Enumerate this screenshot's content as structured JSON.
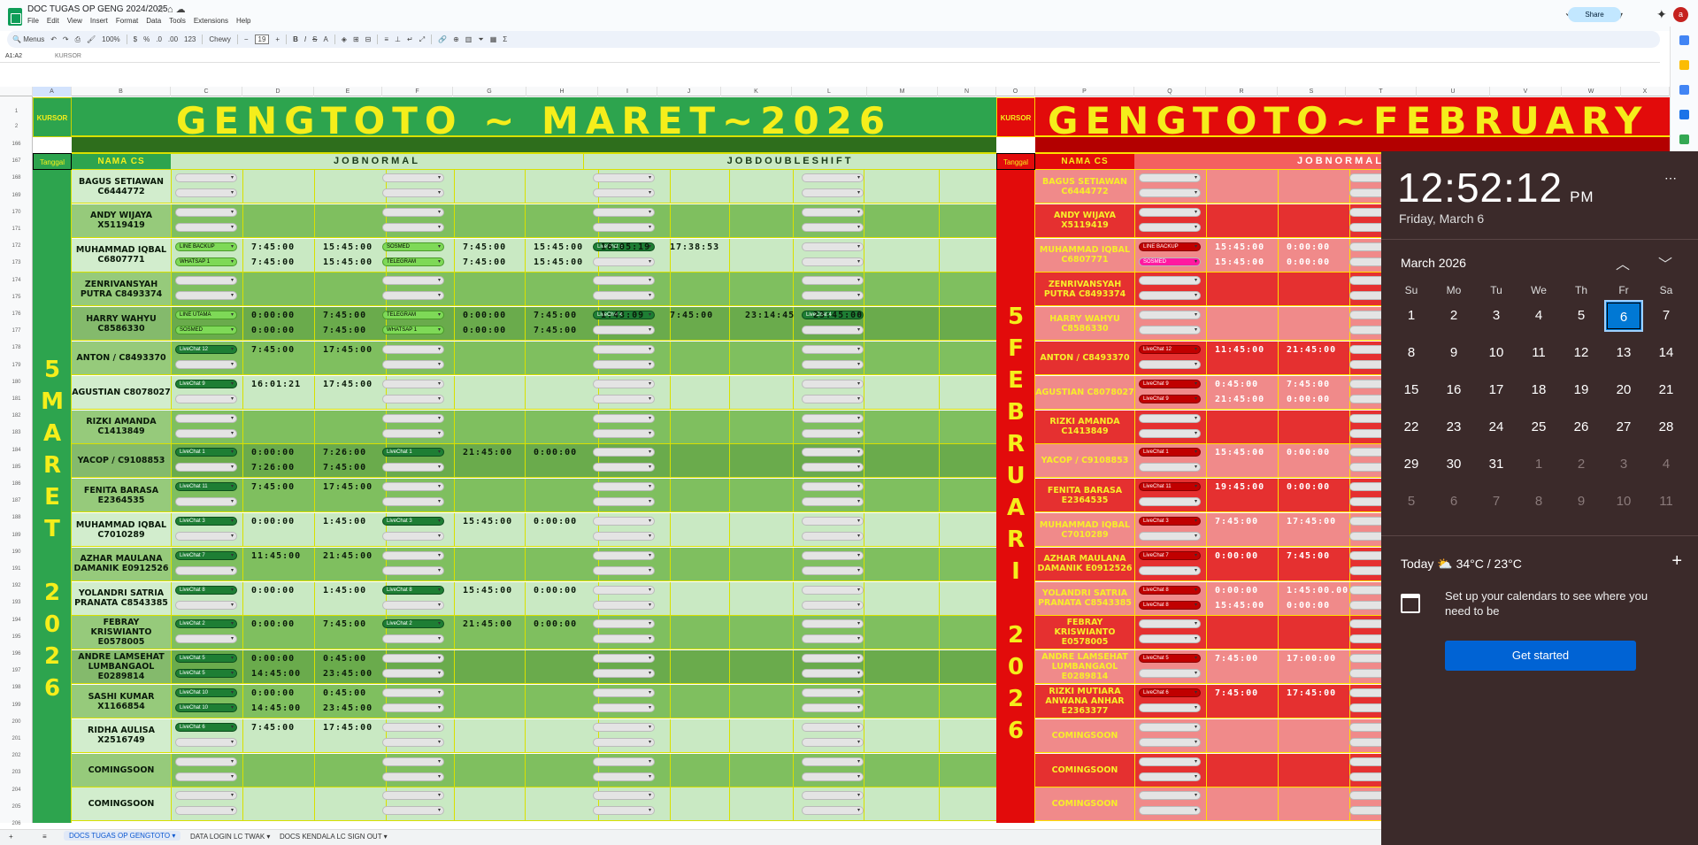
{
  "app": {
    "title": "DOC TUGAS OP GENG 2024/2025",
    "menus": [
      "File",
      "Edit",
      "View",
      "Insert",
      "Format",
      "Data",
      "Tools",
      "Extensions",
      "Help"
    ],
    "share_label": "Share",
    "avatar_letter": "a"
  },
  "toolbar": {
    "search_label": "Menus",
    "zoom": "100%",
    "currency": "$",
    "percent": "%",
    "dec_dec": ".0",
    "dec_inc": ".00",
    "num_fmt": "123",
    "font": "Chewy",
    "font_size": "19"
  },
  "formula": {
    "namebox": "A1:A2",
    "content": "KURSOR"
  },
  "sheet": {
    "col_letters": [
      "A",
      "B",
      "C",
      "D",
      "E",
      "F",
      "G",
      "H",
      "I",
      "J",
      "K",
      "L",
      "M",
      "N",
      "O",
      "P",
      "Q",
      "R",
      "S",
      "T",
      "U",
      "V",
      "W",
      "X",
      "Y"
    ],
    "kursor": "KURSOR",
    "banner_left": "GENGTOTO ~ MARET~2026",
    "banner_right": "GENGTOTO~FEBRUARY",
    "tanggal": "Tanggal",
    "nama_cs": "NAMA CS",
    "job_normal": "JOBNORMAL",
    "job_double": "JOBDOUBLESHIFT",
    "date_left": [
      "5",
      "M",
      "A",
      "R",
      "E",
      "T",
      "",
      "2",
      "0",
      "2",
      "6"
    ],
    "date_right": [
      "5",
      "F",
      "E",
      "B",
      "R",
      "U",
      "A",
      "R",
      "I",
      "",
      "2",
      "0",
      "2",
      "6"
    ],
    "row_numbers": [
      "166",
      "167",
      "168",
      "169",
      "170",
      "171",
      "172",
      "173",
      "174",
      "175",
      "176",
      "177",
      "178",
      "179",
      "180",
      "181",
      "182",
      "183",
      "184",
      "185",
      "186",
      "187",
      "188",
      "189",
      "190",
      "191",
      "192",
      "193",
      "194",
      "195",
      "196",
      "197",
      "198",
      "199",
      "200",
      "201",
      "202",
      "203",
      "204",
      "205",
      "206"
    ],
    "left_rows": [
      {
        "name": "BAGUS SETIAWAN C6444772",
        "dd1": "",
        "dd2": "",
        "times1": [],
        "times2": []
      },
      {
        "name": "ANDY WIJAYA X5119419",
        "dd1": "",
        "dd2": "",
        "times1": [],
        "times2": []
      },
      {
        "name": "MUHAMMAD IQBAL C6807771",
        "dd1": "LINE BACKUP",
        "dd2": "WHATSAP 1",
        "ddf1": "SOSMED",
        "ddf2": "TELEGRAM",
        "ddi1": "LiveChat 6",
        "times1": [
          "7:45:00",
          "15:45:00",
          "7:45:00",
          "15:45:00",
          "16:05:19",
          "17:38:53"
        ],
        "times2": [
          "7:45:00",
          "15:45:00",
          "7:45:00",
          "15:45:00"
        ]
      },
      {
        "name": "ZENRIVANSYAH PUTRA C8493374",
        "dd1": "",
        "dd2": "",
        "times1": [],
        "times2": []
      },
      {
        "name": "HARRY WAHYU C8586330",
        "dd1": "LINE UTAMA",
        "dd2": "SOSMED",
        "ddf1": "TELEGRAM",
        "ddf2": "WHATSAP 1",
        "ddi1": "LiveChat 4",
        "ddl1": "LiveChat 4",
        "times1": [
          "0:00:00",
          "7:45:00",
          "0:00:00",
          "7:45:00",
          "1:43:09",
          "7:45:00",
          "23:14:45",
          "23:45:00"
        ],
        "times2": [
          "0:00:00",
          "7:45:00",
          "0:00:00",
          "7:45:00"
        ]
      },
      {
        "name": "ANTON / C8493370",
        "dd1": "LiveChat 12",
        "dd2": "",
        "times1": [
          "7:45:00",
          "17:45:00"
        ],
        "times2": []
      },
      {
        "name": "AGUSTIAN C8078027",
        "dd1": "LiveChat 9",
        "dd2": "",
        "times1": [
          "16:01:21",
          "17:45:00"
        ],
        "times2": []
      },
      {
        "name": "RIZKI AMANDA C1413849",
        "dd1": "",
        "dd2": "",
        "times1": [],
        "times2": []
      },
      {
        "name": "YACOP / C9108853",
        "dd1": "LiveChat 1",
        "dd2": "",
        "ddf1": "LiveChat 1",
        "times1": [
          "0:00:00",
          "7:26:00",
          "21:45:00",
          "0:00:00"
        ],
        "times2": [
          "7:26:00",
          "7:45:00"
        ]
      },
      {
        "name": "FENITA BARASA E2364535",
        "dd1": "LiveChat 11",
        "dd2": "",
        "times1": [
          "7:45:00",
          "17:45:00"
        ],
        "times2": []
      },
      {
        "name": "MUHAMMAD IQBAL C7010289",
        "dd1": "LiveChat 3",
        "dd2": "",
        "ddf1": "LiveChat 3",
        "times1": [
          "0:00:00",
          "1:45:00",
          "15:45:00",
          "0:00:00"
        ],
        "times2": []
      },
      {
        "name": "AZHAR MAULANA DAMANIK E0912526",
        "dd1": "LiveChat 7",
        "dd2": "",
        "times1": [
          "11:45:00",
          "21:45:00"
        ],
        "times2": []
      },
      {
        "name": "YOLANDRI SATRIA PRANATA C8543385",
        "dd1": "LiveChat 8",
        "dd2": "",
        "ddf1": "LiveChat 8",
        "times1": [
          "0:00:00",
          "1:45:00",
          "15:45:00",
          "0:00:00"
        ],
        "times2": []
      },
      {
        "name": "FEBRAY KRISWIANTO E0578005",
        "dd1": "LiveChat 2",
        "dd2": "",
        "ddf1": "LiveChat 2",
        "times1": [
          "0:00:00",
          "7:45:00",
          "21:45:00",
          "0:00:00"
        ],
        "times2": []
      },
      {
        "name": "ANDRE LAMSEHAT LUMBANGAOL E0289814",
        "dd1": "LiveChat 5",
        "dd2": "LiveChat 5",
        "times1": [
          "0:00:00",
          "0:45:00"
        ],
        "times2": [
          "14:45:00",
          "23:45:00"
        ]
      },
      {
        "name": "SASHI KUMAR X1166854",
        "dd1": "LiveChat 10",
        "dd2": "LiveChat 10",
        "times1": [
          "0:00:00",
          "0:45:00"
        ],
        "times2": [
          "14:45:00",
          "23:45:00"
        ]
      },
      {
        "name": "RIDHA AULISA X2516749",
        "dd1": "LiveChat 6",
        "dd2": "",
        "times1": [
          "7:45:00",
          "17:45:00"
        ],
        "times2": []
      },
      {
        "name": "COMINGSOON",
        "dd1": "",
        "dd2": "",
        "times1": [],
        "times2": []
      },
      {
        "name": "COMINGSOON",
        "dd1": "",
        "dd2": "",
        "times1": [],
        "times2": []
      }
    ],
    "right_rows": [
      {
        "name": "BAGUS SETIAWAN C6444772",
        "dd1": "",
        "dd2": "",
        "times1": [],
        "times2": []
      },
      {
        "name": "ANDY WIJAYA X5119419",
        "dd1": "",
        "dd2": "",
        "times1": [],
        "times2": []
      },
      {
        "name": "MUHAMMAD IQBAL C6807771",
        "dd1": "LINE BACKUP",
        "dd2": "SOSMED",
        "ddx": "TELEGRA",
        "ddx2": "WHATSAP",
        "times1": [
          "15:45:00",
          "0:00:00"
        ],
        "times2": [
          "15:45:00",
          "0:00:00"
        ]
      },
      {
        "name": "ZENRIVANSYAH PUTRA C8493374",
        "dd1": "",
        "dd2": "",
        "times1": [],
        "times2": []
      },
      {
        "name": "HARRY WAHYU C8586330",
        "dd1": "",
        "dd2": "",
        "times1": [],
        "times2": []
      },
      {
        "name": "ANTON / C8493370",
        "dd1": "LiveChat 12",
        "dd2": "",
        "times1": [
          "11:45:00",
          "21:45:00"
        ],
        "times2": []
      },
      {
        "name": "AGUSTIAN C8078027",
        "dd1": "LiveChat 9",
        "dd2": "LiveChat 9",
        "times1": [
          "0:45:00",
          "7:45:00"
        ],
        "times2": [
          "21:45:00",
          "0:00:00"
        ]
      },
      {
        "name": "RIZKI AMANDA C1413849",
        "dd1": "",
        "dd2": "",
        "times1": [],
        "times2": []
      },
      {
        "name": "YACOP / C9108853",
        "dd1": "LiveChat 1",
        "dd2": "",
        "times1": [
          "15:45:00",
          "0:00:00"
        ],
        "times2": []
      },
      {
        "name": "FENITA BARASA E2364535",
        "dd1": "LiveChat 11",
        "dd2": "",
        "ddx": "LiveChat",
        "times1": [
          "19:45:00",
          "0:00:00"
        ],
        "times2": []
      },
      {
        "name": "MUHAMMAD IQBAL C7010289",
        "dd1": "LiveChat 3",
        "dd2": "",
        "times1": [
          "7:45:00",
          "17:45:00"
        ],
        "times2": []
      },
      {
        "name": "AZHAR MAULANA DAMANIK E0912526",
        "dd1": "LiveChat 7",
        "dd2": "",
        "times1": [
          "0:00:00",
          "7:45:00"
        ],
        "times2": []
      },
      {
        "name": "YOLANDRI SATRIA PRANATA C8543385",
        "dd1": "LiveChat 8",
        "dd2": "LiveChat 8",
        "times1": [
          "0:00:00",
          "1:45:00.00"
        ],
        "times2": [
          "15:45:00",
          "0:00:00"
        ]
      },
      {
        "name": "FEBRAY KRISWIANTO E0578005",
        "dd1": "",
        "dd2": "",
        "times1": [],
        "times2": []
      },
      {
        "name": "ANDRE LAMSEHAT LUMBANGAOL E0289814",
        "dd1": "LiveChat 5",
        "dd2": "",
        "times1": [
          "7:45:00",
          "17:00:00"
        ],
        "times2": []
      },
      {
        "name": "RIZKI MUTIARA ANWANA ANHAR E2363377",
        "dd1": "LiveChat 6",
        "dd2": "",
        "times1": [
          "7:45:00",
          "17:45:00"
        ],
        "times2": []
      },
      {
        "name": "COMINGSOON",
        "dd1": "",
        "dd2": "",
        "times1": [],
        "times2": []
      },
      {
        "name": "COMINGSOON",
        "dd1": "",
        "dd2": "",
        "times1": [],
        "times2": []
      },
      {
        "name": "COMINGSOON",
        "dd1": "",
        "dd2": "",
        "times1": [],
        "times2": []
      }
    ]
  },
  "tabs": [
    "DOCS TUGAS OP GENGTOTO",
    "DATA LOGIN LC TWAK",
    "DOCS KENDALA LC SIGN OUT"
  ],
  "calendar": {
    "time": "12:52:12",
    "ampm": "PM",
    "date": "Friday, March 6",
    "month": "March 2026",
    "weekdays": [
      "Su",
      "Mo",
      "Tu",
      "We",
      "Th",
      "Fr",
      "Sa"
    ],
    "days": [
      [
        "1",
        "2",
        "3",
        "4",
        "5",
        "6",
        "7"
      ],
      [
        "8",
        "9",
        "10",
        "11",
        "12",
        "13",
        "14"
      ],
      [
        "15",
        "16",
        "17",
        "18",
        "19",
        "20",
        "21"
      ],
      [
        "22",
        "23",
        "24",
        "25",
        "26",
        "27",
        "28"
      ],
      [
        "29",
        "30",
        "31",
        "1",
        "2",
        "3",
        "4"
      ],
      [
        "5",
        "6",
        "7",
        "8",
        "9",
        "10",
        "11"
      ]
    ],
    "selected": "6",
    "today_label": "Today",
    "weather": "34°C / 23°C",
    "setup_text": "Set up your calendars to see where you need to be",
    "button": "Get started"
  },
  "colors": {
    "green": "#2da44e",
    "red": "#e20b0b",
    "yellow": "#f5ee1b",
    "accent": "#0078d4"
  }
}
